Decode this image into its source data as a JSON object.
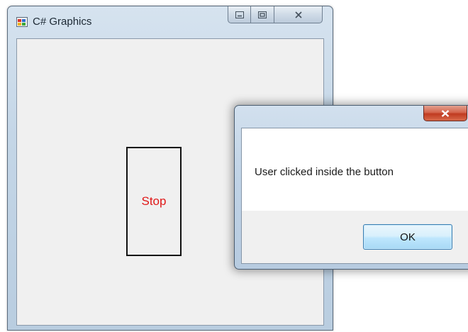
{
  "main_window": {
    "title": "C# Graphics",
    "icons": {
      "app": "app-window-icon",
      "minimize": "minimize-icon",
      "maximize": "maximize-icon",
      "close": "close-icon"
    }
  },
  "canvas": {
    "stop_button_label": "Stop",
    "stop_label_color": "#e01818"
  },
  "message_box": {
    "message": "User clicked inside the button",
    "ok_label": "OK",
    "close_icon": "close-icon",
    "close_color": "#c94a2f"
  }
}
